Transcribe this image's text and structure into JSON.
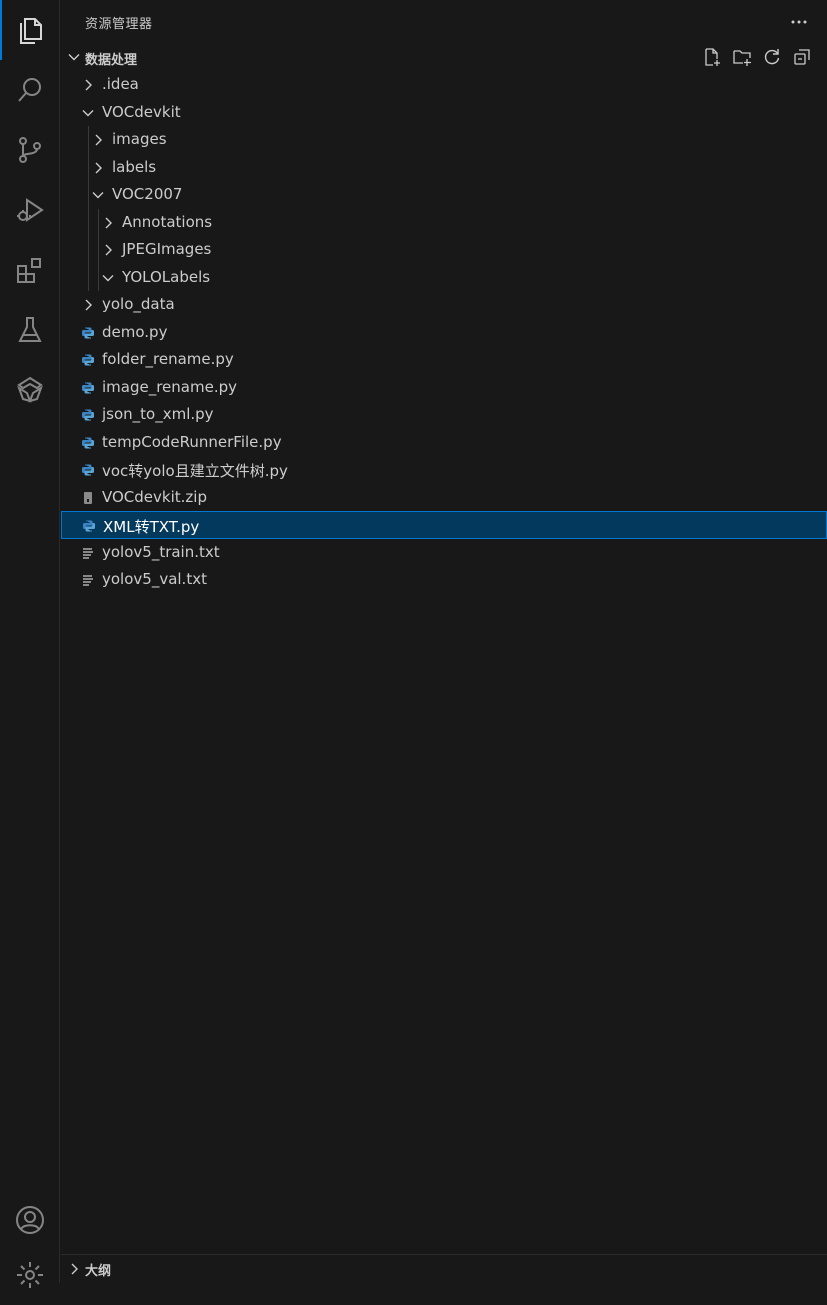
{
  "activity_bar": {
    "items": [
      {
        "name": "explorer-icon",
        "active": true
      },
      {
        "name": "search-icon"
      },
      {
        "name": "source-control-icon"
      },
      {
        "name": "run-debug-icon"
      },
      {
        "name": "extensions-icon"
      },
      {
        "name": "testing-icon"
      },
      {
        "name": "extension-logo-icon"
      }
    ],
    "bottom": [
      {
        "name": "account-icon"
      },
      {
        "name": "settings-gear-icon"
      }
    ],
    "accent": "#0078d4"
  },
  "sidebar": {
    "title": "资源管理器",
    "section": {
      "title": "数据处理",
      "actions": [
        "new-file-icon",
        "new-folder-icon",
        "refresh-icon",
        "collapse-all-icon"
      ]
    },
    "tree": [
      {
        "label": ".idea",
        "depth": 1,
        "type": "folder",
        "expanded": false
      },
      {
        "label": "VOCdevkit",
        "depth": 1,
        "type": "folder",
        "expanded": true
      },
      {
        "label": "images",
        "depth": 2,
        "type": "folder",
        "expanded": false
      },
      {
        "label": "labels",
        "depth": 2,
        "type": "folder",
        "expanded": false
      },
      {
        "label": "VOC2007",
        "depth": 2,
        "type": "folder",
        "expanded": true
      },
      {
        "label": "Annotations",
        "depth": 3,
        "type": "folder",
        "expanded": false
      },
      {
        "label": "JPEGImages",
        "depth": 3,
        "type": "folder",
        "expanded": false
      },
      {
        "label": "YOLOLabels",
        "depth": 3,
        "type": "folder",
        "expanded": true
      },
      {
        "label": "yolo_data",
        "depth": 1,
        "type": "folder",
        "expanded": false
      },
      {
        "label": "demo.py",
        "depth": 1,
        "type": "python"
      },
      {
        "label": "folder_rename.py",
        "depth": 1,
        "type": "python"
      },
      {
        "label": "image_rename.py",
        "depth": 1,
        "type": "python"
      },
      {
        "label": "json_to_xml.py",
        "depth": 1,
        "type": "python"
      },
      {
        "label": "tempCodeRunnerFile.py",
        "depth": 1,
        "type": "python"
      },
      {
        "label": "voc转yolo且建立文件树.py",
        "depth": 1,
        "type": "python"
      },
      {
        "label": "VOCdevkit.zip",
        "depth": 1,
        "type": "zip"
      },
      {
        "label": "XML转TXT.py",
        "depth": 1,
        "type": "python",
        "selected": true
      },
      {
        "label": "yolov5_train.txt",
        "depth": 1,
        "type": "text"
      },
      {
        "label": "yolov5_val.txt",
        "depth": 1,
        "type": "text"
      }
    ],
    "outline_title": "大纲"
  }
}
